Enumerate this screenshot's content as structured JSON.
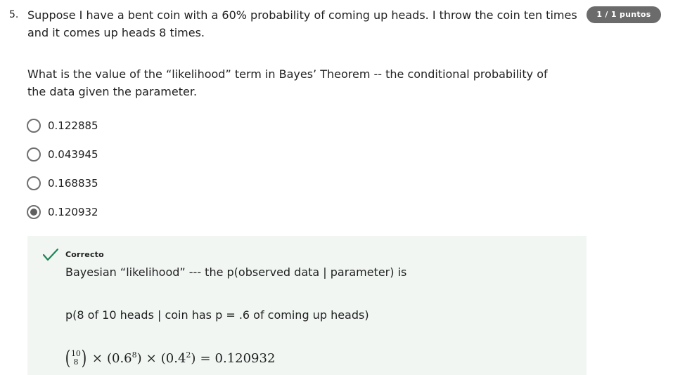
{
  "question": {
    "number": "5.",
    "text": "Suppose I have a bent coin with a 60% probability of coming up heads. I throw the coin ten times and it comes up heads 8 times.",
    "subtext": "What is the value of the “likelihood” term in Bayes’ Theorem -- the conditional probability of the data given the parameter.",
    "score": "1 / 1 puntos"
  },
  "options": [
    {
      "label": "0.122885",
      "selected": false
    },
    {
      "label": "0.043945",
      "selected": false
    },
    {
      "label": "0.168835",
      "selected": false
    },
    {
      "label": "0.120932",
      "selected": true
    }
  ],
  "feedback": {
    "status": "Correcto",
    "line1": "Bayesian “likelihood” --- the p(observed data | parameter) is",
    "line2": "p(8 of 10 heads | coin has p = .6 of coming up heads)",
    "formula": {
      "binom_top": "10",
      "binom_bottom": "8",
      "times": "×",
      "term1": "(0.6",
      "term1_exp": "8",
      "term1_close": ")",
      "term2": "(0.4",
      "term2_exp": "2",
      "term2_close": ")",
      "equals": "=",
      "result": "0.120932"
    },
    "accent_color": "#1f8354"
  }
}
